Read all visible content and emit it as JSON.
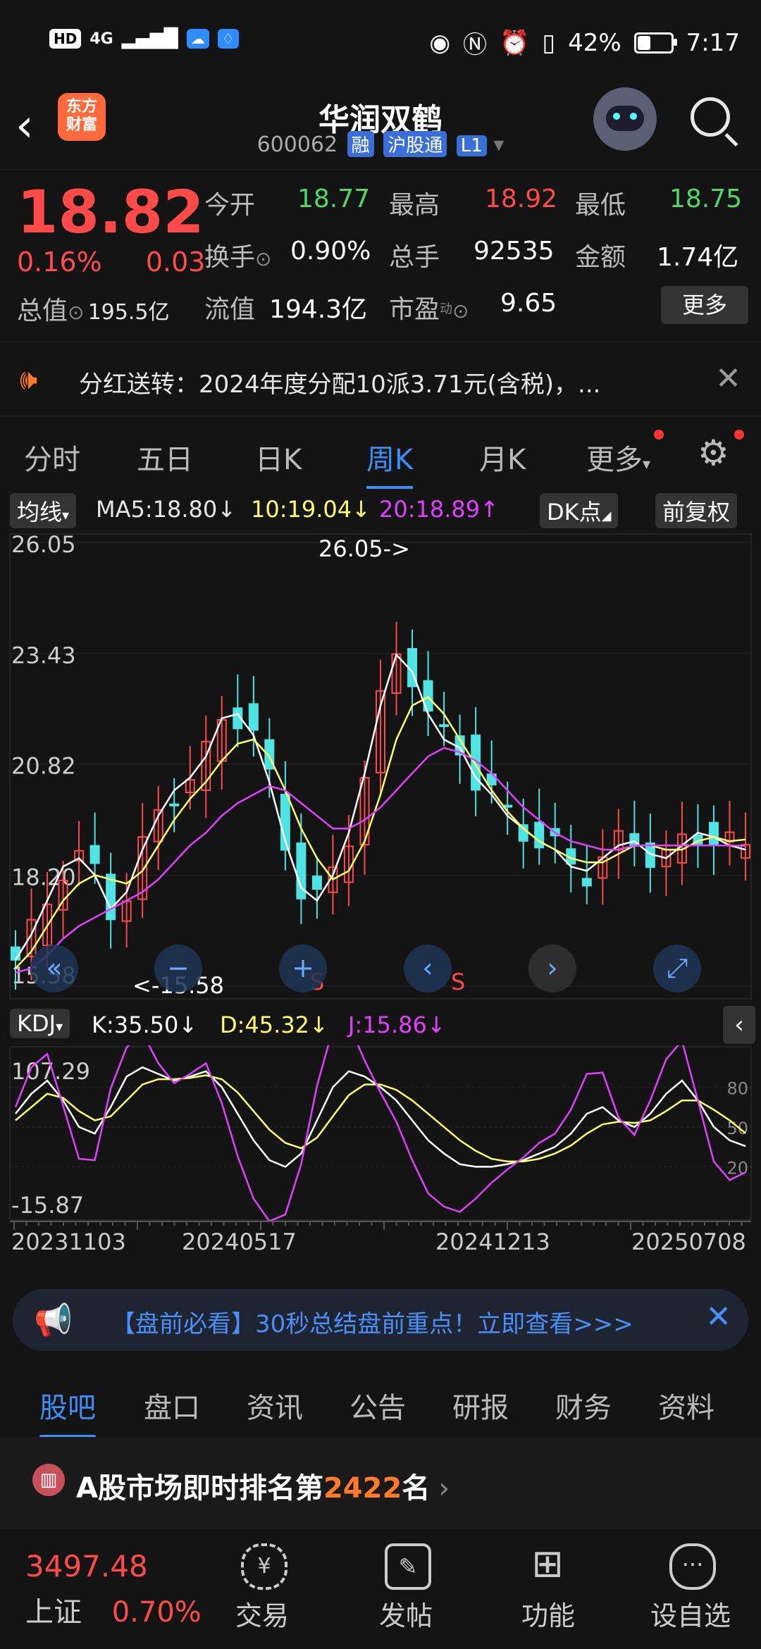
{
  "status_bar": {
    "left_chips": [
      "HD",
      "4G"
    ],
    "battery_percent": "42%",
    "battery_level": 0.42,
    "time": "7:17"
  },
  "header": {
    "logo_text_line1": "东方",
    "logo_text_line2": "财富",
    "title": "华润双鹤",
    "code": "600062",
    "tags": [
      "融",
      "沪股通",
      "L1"
    ]
  },
  "quote": {
    "price": "18.82",
    "change_pct": "0.16%",
    "change_abs": "0.03",
    "rows": [
      [
        {
          "label": "今开",
          "value": "18.77",
          "color": "green"
        },
        {
          "label": "最高",
          "value": "18.92",
          "color": "red"
        },
        {
          "label": "最低",
          "value": "18.75",
          "color": "green"
        }
      ],
      [
        {
          "label": "换手",
          "value": "0.90%",
          "color": "white"
        },
        {
          "label": "总手",
          "value": "92535",
          "color": "white"
        },
        {
          "label": "金额",
          "value": "1.74亿",
          "color": "white"
        }
      ],
      [
        {
          "label": "流值",
          "value": "194.3亿",
          "color": "white"
        },
        {
          "label": "市盈",
          "value": "9.65",
          "color": "white"
        }
      ]
    ],
    "total_value_label": "总值",
    "total_value": "195.5亿",
    "pe_superscript": "动",
    "more_button": "更多"
  },
  "notice": {
    "text": "分红送转：2024年度分配10派3.71元(含税)，..."
  },
  "chart_tabs": [
    "分时",
    "五日",
    "日K",
    "周K",
    "月K",
    "更多"
  ],
  "active_chart_tab": "周K",
  "ma_bar": {
    "label": "均线",
    "ma5": "MA5:18.80↓",
    "ma10": "10:19.04↓",
    "ma20": "20:18.89↑",
    "dk_label": "DK点",
    "adjust_label": "前复权",
    "colors": {
      "ma5": "#ffffff",
      "ma10": "#ffff66",
      "ma20": "#e040fb"
    }
  },
  "kdj_bar": {
    "label": "KDJ",
    "k": "K:35.50↓",
    "d": "D:45.32↓",
    "j": "J:15.86↓"
  },
  "chart_data": [
    {
      "type": "candlestick",
      "y_ticks": [
        "26.05",
        "23.43",
        "20.82",
        "18.20",
        "15.58"
      ],
      "ylim": [
        15.58,
        26.05
      ],
      "annotations": [
        "26.05->",
        "<-15.58"
      ],
      "markers": [
        "S",
        "S"
      ],
      "colors": {
        "up": "#ff4a4a",
        "down": "#4fe3e3"
      },
      "series": [
        {
          "name": "MA5",
          "values": [
            16.2,
            16.8,
            17.6,
            18.4,
            18.6,
            18.2,
            17.4,
            17.8,
            18.8,
            19.6,
            20.2,
            20.5,
            21.0,
            21.9,
            22.0,
            21.5,
            20.4,
            19.0,
            17.9,
            17.6,
            18.2,
            19.2,
            20.6,
            22.2,
            23.4,
            23.0,
            22.0,
            21.4,
            21.2,
            20.5,
            20.1,
            19.6,
            19.3,
            19.0,
            18.8,
            18.4,
            18.3,
            18.6,
            18.9,
            19.0,
            18.7,
            18.6,
            18.9,
            19.2,
            19.1,
            18.9,
            18.8
          ]
        },
        {
          "name": "10",
          "values": [
            16.0,
            16.4,
            17.0,
            17.6,
            18.0,
            18.2,
            18.1,
            18.0,
            18.3,
            18.9,
            19.5,
            20.0,
            20.4,
            20.9,
            21.3,
            21.4,
            21.0,
            20.2,
            19.3,
            18.6,
            18.1,
            18.3,
            19.0,
            20.1,
            21.4,
            22.2,
            22.4,
            22.0,
            21.4,
            20.8,
            20.2,
            19.7,
            19.3,
            19.0,
            18.8,
            18.6,
            18.5,
            18.5,
            18.7,
            18.9,
            18.9,
            18.8,
            18.8,
            19.0,
            19.1,
            19.0,
            19.04
          ]
        },
        {
          "name": "20",
          "values": [
            15.9,
            16.0,
            16.3,
            16.7,
            17.0,
            17.2,
            17.4,
            17.6,
            17.8,
            18.1,
            18.5,
            18.9,
            19.2,
            19.6,
            19.9,
            20.1,
            20.3,
            20.2,
            19.9,
            19.6,
            19.3,
            19.3,
            19.5,
            19.8,
            20.2,
            20.6,
            21.0,
            21.2,
            21.1,
            20.9,
            20.6,
            20.2,
            19.8,
            19.5,
            19.2,
            19.0,
            18.9,
            18.8,
            18.8,
            18.9,
            18.9,
            18.9,
            18.9,
            18.9,
            18.9,
            18.9,
            18.89
          ]
        }
      ]
    },
    {
      "type": "line",
      "y_ticks": [
        "107.29",
        "-15.87"
      ],
      "right_ticks": [
        "80",
        "50",
        "20"
      ],
      "ylim": [
        -15.87,
        107.29
      ],
      "x_ticks": [
        "20231103",
        "20240517",
        "20241213",
        "20250708"
      ],
      "series": [
        {
          "name": "K",
          "values": [
            60,
            75,
            85,
            70,
            50,
            45,
            65,
            88,
            95,
            90,
            85,
            88,
            92,
            80,
            60,
            40,
            25,
            20,
            30,
            55,
            80,
            92,
            88,
            80,
            70,
            55,
            40,
            30,
            22,
            20,
            20,
            22,
            25,
            30,
            35,
            45,
            60,
            65,
            55,
            50,
            60,
            75,
            85,
            70,
            50,
            40,
            35.5
          ]
        },
        {
          "name": "D",
          "values": [
            55,
            65,
            75,
            72,
            62,
            55,
            58,
            70,
            82,
            86,
            86,
            87,
            89,
            86,
            76,
            62,
            48,
            38,
            34,
            42,
            58,
            74,
            82,
            82,
            78,
            70,
            60,
            50,
            40,
            32,
            26,
            24,
            24,
            26,
            30,
            36,
            45,
            52,
            54,
            53,
            55,
            62,
            70,
            70,
            63,
            55,
            45.32
          ]
        },
        {
          "name": "J",
          "values": [
            65,
            95,
            105,
            66,
            26,
            25,
            79,
            110,
            121,
            98,
            83,
            90,
            98,
            68,
            28,
            -4,
            -21,
            -16,
            22,
            81,
            124,
            128,
            100,
            76,
            54,
            25,
            0,
            -10,
            -14,
            -4,
            8,
            18,
            27,
            38,
            45,
            63,
            90,
            91,
            57,
            44,
            70,
            101,
            115,
            70,
            24,
            10,
            15.86
          ]
        }
      ]
    }
  ],
  "banner": {
    "text": "【盘前必看】30秒总结盘前重点！立即查看>>>"
  },
  "bottom_tabs": [
    "股吧",
    "盘口",
    "资讯",
    "公告",
    "研报",
    "财务",
    "资料"
  ],
  "active_bottom_tab": "股吧",
  "rank": {
    "prefix": "A股市场即时排名第",
    "number": "2422",
    "suffix": "名"
  },
  "nav": {
    "index_value": "3497.48",
    "index_name": "上证",
    "index_change": "0.70%",
    "items": [
      "交易",
      "发帖",
      "功能",
      "设自选"
    ]
  }
}
